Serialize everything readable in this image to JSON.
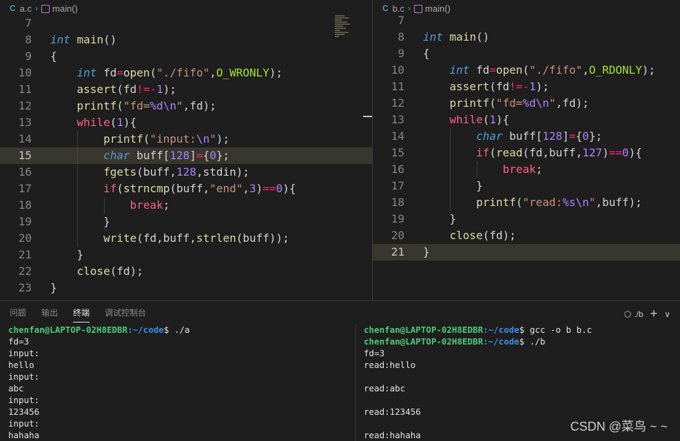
{
  "left_editor": {
    "file_icon": "C",
    "file": "a.c",
    "symbol": "main()",
    "current_line": "15",
    "lines": [
      {
        "n": "7",
        "t": ""
      },
      {
        "n": "8",
        "t": "int main()"
      },
      {
        "n": "9",
        "t": "{"
      },
      {
        "n": "10",
        "t": "    int fd=open(\"./fifo\",O_WRONLY);"
      },
      {
        "n": "11",
        "t": "    assert(fd!=-1);"
      },
      {
        "n": "12",
        "t": "    printf(\"fd=%d\\n\",fd);"
      },
      {
        "n": "13",
        "t": "    while(1){"
      },
      {
        "n": "14",
        "t": "        printf(\"input:\\n\");"
      },
      {
        "n": "15",
        "t": "        char buff[128]={0};"
      },
      {
        "n": "16",
        "t": "        fgets(buff,128,stdin);"
      },
      {
        "n": "17",
        "t": "        if(strncmp(buff,\"end\",3)==0){"
      },
      {
        "n": "18",
        "t": "            break;"
      },
      {
        "n": "19",
        "t": "        }"
      },
      {
        "n": "20",
        "t": "        write(fd,buff,strlen(buff));"
      },
      {
        "n": "21",
        "t": "    }"
      },
      {
        "n": "22",
        "t": "    close(fd);"
      },
      {
        "n": "23",
        "t": "}"
      }
    ]
  },
  "right_editor": {
    "file_icon": "C",
    "file": "b.c",
    "symbol": "main()",
    "current_line": "21",
    "lines": [
      {
        "n": "7",
        "t": ""
      },
      {
        "n": "8",
        "t": "int main()"
      },
      {
        "n": "9",
        "t": "{"
      },
      {
        "n": "10",
        "t": "    int fd=open(\"./fifo\",O_RDONLY);"
      },
      {
        "n": "11",
        "t": "    assert(fd!=-1);"
      },
      {
        "n": "12",
        "t": "    printf(\"fd=%d\\n\",fd);"
      },
      {
        "n": "13",
        "t": "    while(1){"
      },
      {
        "n": "14",
        "t": "        char buff[128]={0};"
      },
      {
        "n": "15",
        "t": "        if(read(fd,buff,127)==0){"
      },
      {
        "n": "16",
        "t": "            break;"
      },
      {
        "n": "17",
        "t": "        }"
      },
      {
        "n": "18",
        "t": "        printf(\"read:%s\\n\",buff);"
      },
      {
        "n": "19",
        "t": "    }"
      },
      {
        "n": "20",
        "t": "    close(fd);"
      },
      {
        "n": "21",
        "t": "}"
      }
    ]
  },
  "panel": {
    "tabs": [
      "问题",
      "输出",
      "终端",
      "调试控制台"
    ],
    "active_tab": "终端",
    "terminal_name": "./b",
    "add_label": "+",
    "dropdown_label": "∨"
  },
  "terminal_left": [
    {
      "prompt_user": "chenfan@LAPTOP-02H8EDBR",
      "prompt_path": ":~/code",
      "cmd": "$ ./a"
    },
    {
      "out": "fd=3"
    },
    {
      "out": "input:"
    },
    {
      "out": "hello"
    },
    {
      "out": "input:"
    },
    {
      "out": "abc"
    },
    {
      "out": "input:"
    },
    {
      "out": "123456"
    },
    {
      "out": "input:"
    },
    {
      "out": "hahaha"
    }
  ],
  "terminal_right": [
    {
      "prompt_user": "chenfan@LAPTOP-02H8EDBR",
      "prompt_path": ":~/code",
      "cmd": "$ gcc -o b b.c"
    },
    {
      "prompt_user": "chenfan@LAPTOP-02H8EDBR",
      "prompt_path": ":~/code",
      "cmd": "$ ./b"
    },
    {
      "out": "fd=3"
    },
    {
      "out": "read:hello"
    },
    {
      "out": ""
    },
    {
      "out": "read:abc"
    },
    {
      "out": ""
    },
    {
      "out": "read:123456"
    },
    {
      "out": ""
    },
    {
      "out": "read:hahaha"
    }
  ],
  "watermark": "CSDN @菜鸟 ~ ~",
  "colors": {
    "background": "#1e1e1e",
    "current_line": "#37372d",
    "keyword": "#569cd6",
    "function": "#dcdcaa",
    "control": "#ff5f87",
    "string": "#ce9178",
    "number": "#ae81ff",
    "prompt_user": "#4ec97b",
    "prompt_path": "#3b8eea"
  },
  "icons": [
    "c-file-icon",
    "chevron-right-icon",
    "cube-symbol-icon",
    "terminal-icon",
    "plus-icon",
    "chevron-down-icon"
  ]
}
